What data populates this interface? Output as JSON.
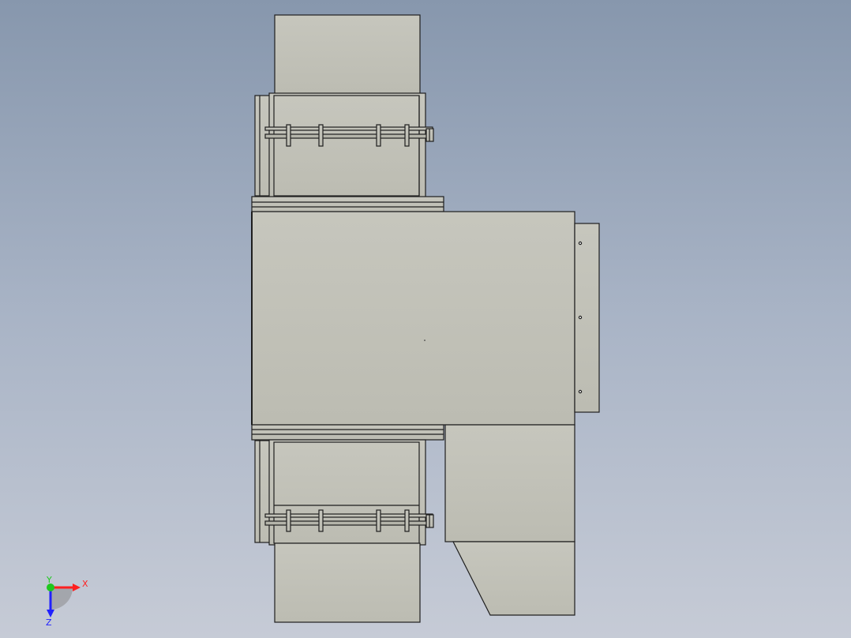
{
  "viewport": {
    "background_top": "#8797ad",
    "background_bottom": "#c6cbd6",
    "part_fill": "#c2c2b8",
    "part_edge": "#1e1e1e",
    "part_fill_shadow": "#b1b1a6"
  },
  "triad": {
    "x_label": "X",
    "z_label": "Z",
    "y_label": "Y",
    "x_color": "#ff2020",
    "y_color": "#1ec81e",
    "z_color": "#2020ff",
    "x_icon": "arrow-right-icon",
    "z_icon": "arrow-down-icon"
  }
}
